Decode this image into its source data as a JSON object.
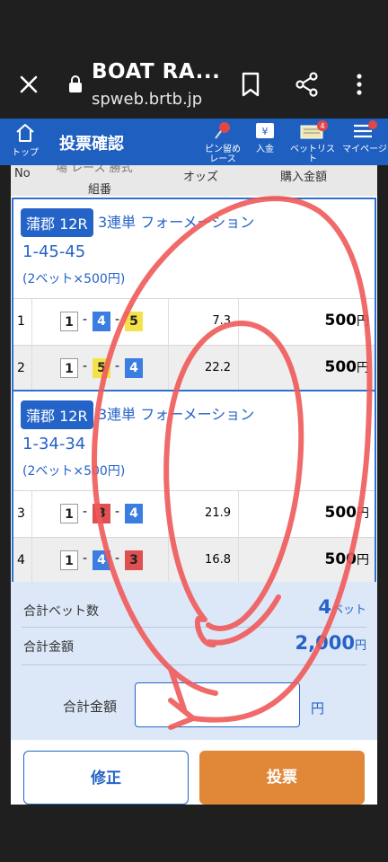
{
  "browser": {
    "title": "BOAT RA...",
    "url": "spweb.brtb.jp"
  },
  "appbar": {
    "home_label": "トップ",
    "page_title": "投票確認",
    "nav": [
      {
        "label": "ピン留め\nレース"
      },
      {
        "label": "入金"
      },
      {
        "label": "ベットリスト",
        "badge": "4"
      },
      {
        "label": "マイページ"
      }
    ]
  },
  "table_header": {
    "no": "No",
    "partial_top": "場 レース 勝式",
    "kumiban": "組番",
    "odds": "オッズ",
    "amount": "購入金額"
  },
  "tickets": [
    {
      "venue": "蒲郡 12R",
      "bet_type": "3連単 フォーメーション",
      "combo": "1-45-45",
      "bets": "(2ベット×500円)",
      "rows": [
        {
          "no": "1",
          "boats": [
            "1",
            "4",
            "5"
          ],
          "odds": "7.3",
          "amount": "500",
          "unit": "円"
        },
        {
          "no": "2",
          "boats": [
            "1",
            "5",
            "4"
          ],
          "odds": "22.2",
          "amount": "500",
          "unit": "円"
        }
      ]
    },
    {
      "venue": "蒲郡 12R",
      "bet_type": "3連単 フォーメーション",
      "combo": "1-34-34",
      "bets": "(2ベット×500円)",
      "rows": [
        {
          "no": "3",
          "boats": [
            "1",
            "3",
            "4"
          ],
          "odds": "21.9",
          "amount": "500",
          "unit": "円"
        },
        {
          "no": "4",
          "boats": [
            "1",
            "4",
            "3"
          ],
          "odds": "16.8",
          "amount": "500",
          "unit": "円"
        }
      ]
    }
  ],
  "summary": {
    "bet_count_label": "合計ベット数",
    "bet_count_value": "4",
    "bet_count_unit": "ベット",
    "total_label": "合計金額",
    "total_value": "2,000",
    "total_unit": "円",
    "pay_label": "合計金額",
    "pay_unit": "円",
    "pay_value": ""
  },
  "buttons": {
    "fix": "修正",
    "vote": "投票"
  },
  "colors": {
    "brand_blue": "#1f5fc0",
    "vote_orange": "#e08838",
    "annotation_red": "#f05a5a"
  }
}
